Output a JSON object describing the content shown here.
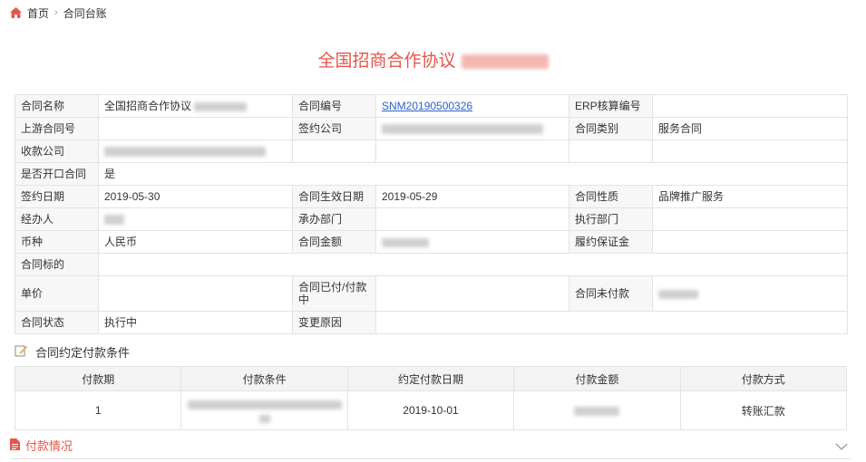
{
  "breadcrumb": {
    "home": "首页",
    "separator": "›",
    "current": "合同台账"
  },
  "title": "全国招商合作协议",
  "info": {
    "row1": {
      "name_label": "合同名称",
      "name_value": "全国招商合作协议",
      "no_label": "合同编号",
      "no_value": "SNM20190500326",
      "erp_label": "ERP核算编号",
      "erp_value": ""
    },
    "row2": {
      "upstream_label": "上游合同号",
      "upstream_value": "",
      "signing_co_label": "签约公司",
      "category_label": "合同类别",
      "category_value": "服务合同"
    },
    "row3": {
      "payee_label": "收款公司"
    },
    "row4": {
      "open_label": "是否开口合同",
      "open_value": "是"
    },
    "row5": {
      "sign_date_label": "签约日期",
      "sign_date_value": "2019-05-30",
      "effective_label": "合同生效日期",
      "effective_value": "2019-05-29",
      "nature_label": "合同性质",
      "nature_value": "品牌推广服务"
    },
    "row6": {
      "handler_label": "经办人",
      "dept_label": "承办部门",
      "dept_value": "",
      "exec_label": "执行部门",
      "exec_value": ""
    },
    "row7": {
      "currency_label": "币种",
      "currency_value": "人民币",
      "amount_label": "合同金额",
      "deposit_label": "履约保证金",
      "deposit_value": ""
    },
    "row8": {
      "subject_label": "合同标的",
      "subject_value": ""
    },
    "row9": {
      "unit_label": "单价",
      "unit_value": "",
      "paid_label": "合同已付/付款中",
      "paid_value": "",
      "unpaid_label": "合同未付款"
    },
    "row10": {
      "status_label": "合同状态",
      "status_value": "执行中",
      "change_label": "变更原因",
      "change_value": ""
    }
  },
  "terms_section": {
    "title": "合同约定付款条件"
  },
  "payment_table": {
    "headers": [
      "付款期",
      "付款条件",
      "约定付款日期",
      "付款金额",
      "付款方式"
    ],
    "rows": [
      {
        "period": "1",
        "date": "2019-10-01",
        "method": "转账汇款"
      }
    ]
  },
  "payment_section": {
    "title": "付款情况"
  },
  "colors": {
    "accent": "#e6564b",
    "link": "#2a62c9"
  },
  "icons": {
    "home": "home-icon",
    "edit": "edit-note-icon",
    "doc": "document-icon",
    "expand": "chevron-down-icon"
  }
}
